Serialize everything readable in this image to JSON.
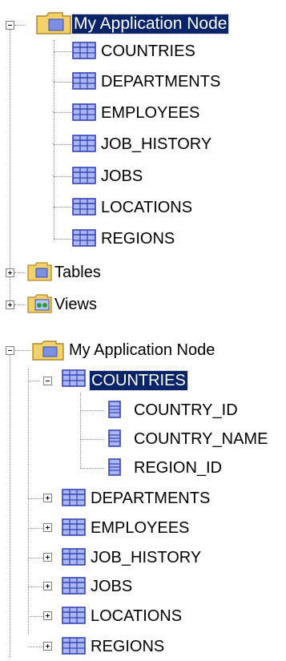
{
  "tree1": {
    "root_label": "My Application Node",
    "tables": [
      "COUNTRIES",
      "DEPARTMENTS",
      "EMPLOYEES",
      "JOB_HISTORY",
      "JOBS",
      "LOCATIONS",
      "REGIONS"
    ],
    "tables_folder_label": "Tables",
    "views_folder_label": "Views"
  },
  "tree2": {
    "root_label": "My Application Node",
    "expanded_table": "COUNTRIES",
    "columns": [
      "COUNTRY_ID",
      "COUNTRY_NAME",
      "REGION_ID"
    ],
    "tables": [
      "DEPARTMENTS",
      "EMPLOYEES",
      "JOB_HISTORY",
      "JOBS",
      "LOCATIONS",
      "REGIONS"
    ]
  },
  "colors": {
    "selection": "#0a246a",
    "folder_yellow": "#f2d06b",
    "table_blue": "#5a6ed8",
    "tree_line": "#888888"
  },
  "icons": {
    "folder": "folder-icon",
    "table": "table-icon",
    "column": "column-icon",
    "view": "view-icon"
  }
}
